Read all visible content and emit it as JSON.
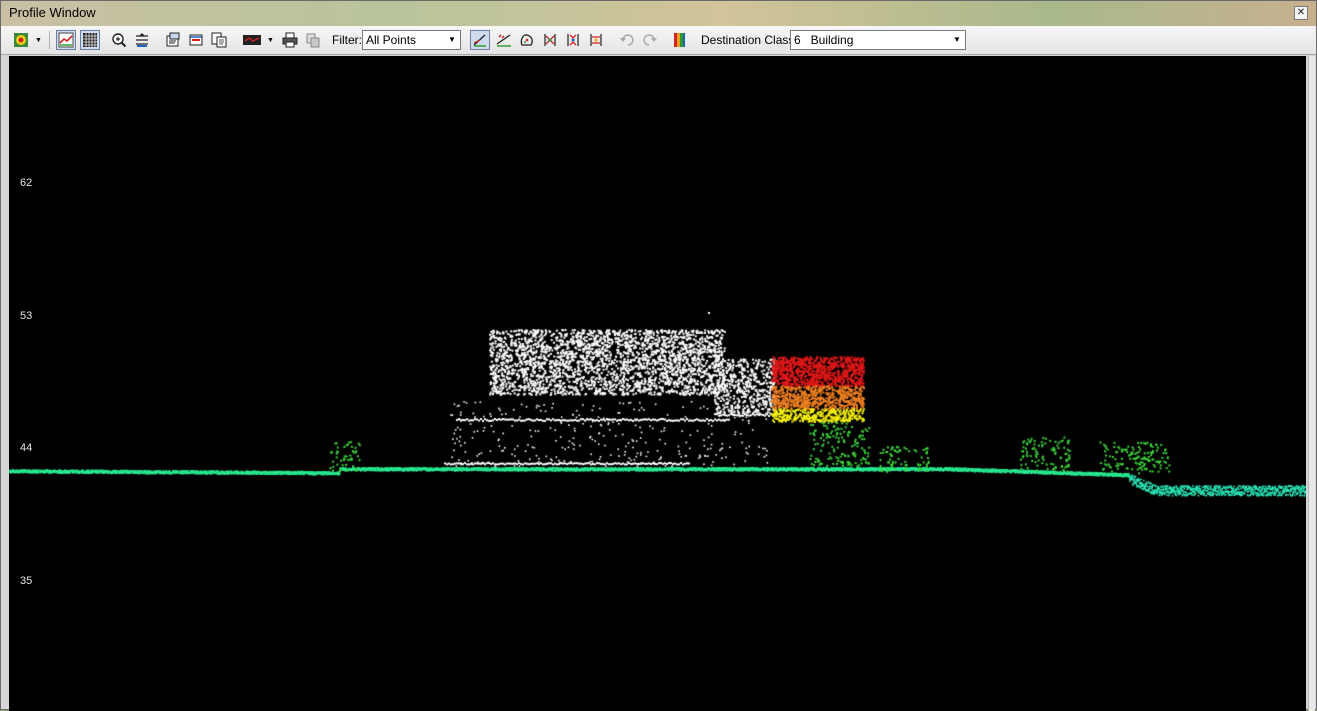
{
  "window": {
    "title": "Profile Window",
    "close_glyph": "✕"
  },
  "toolbar": {
    "filter_label": "Filter:",
    "filter_value": "All Points",
    "dest_class_label": "Destination Class:",
    "dest_class_value": "6   Building",
    "dropdown_glyph": "▼"
  },
  "icons": [
    "color-by-mode-icon",
    "profile-view-icon",
    "grid-icon",
    "zoom-icon",
    "fit-view-icon",
    "properties-icon",
    "export-icon",
    "copy-icon",
    "line-style-icon",
    "print-icon",
    "settings-icon",
    "draw-line-icon",
    "classify-above-line-icon",
    "freehand-fence-icon",
    "classify-low-icon",
    "classify-high-icon",
    "classify-between-icon",
    "undo-icon",
    "redo-icon",
    "class-palette-icon"
  ],
  "profile": {
    "y_ticks": [
      "62",
      "53",
      "44",
      "35"
    ],
    "y_tick_values": [
      62,
      53,
      44,
      35
    ],
    "colors": {
      "background": "#000000",
      "ground": "#29e891",
      "ground_far": "#2be8b8",
      "vegetation": "#3cd23c",
      "building_unclassified": "#ffffff",
      "building_high": "#e01818",
      "building_mid": "#f08020",
      "building_low": "#f5f00a",
      "tick_text": "#e6e6e6"
    }
  }
}
